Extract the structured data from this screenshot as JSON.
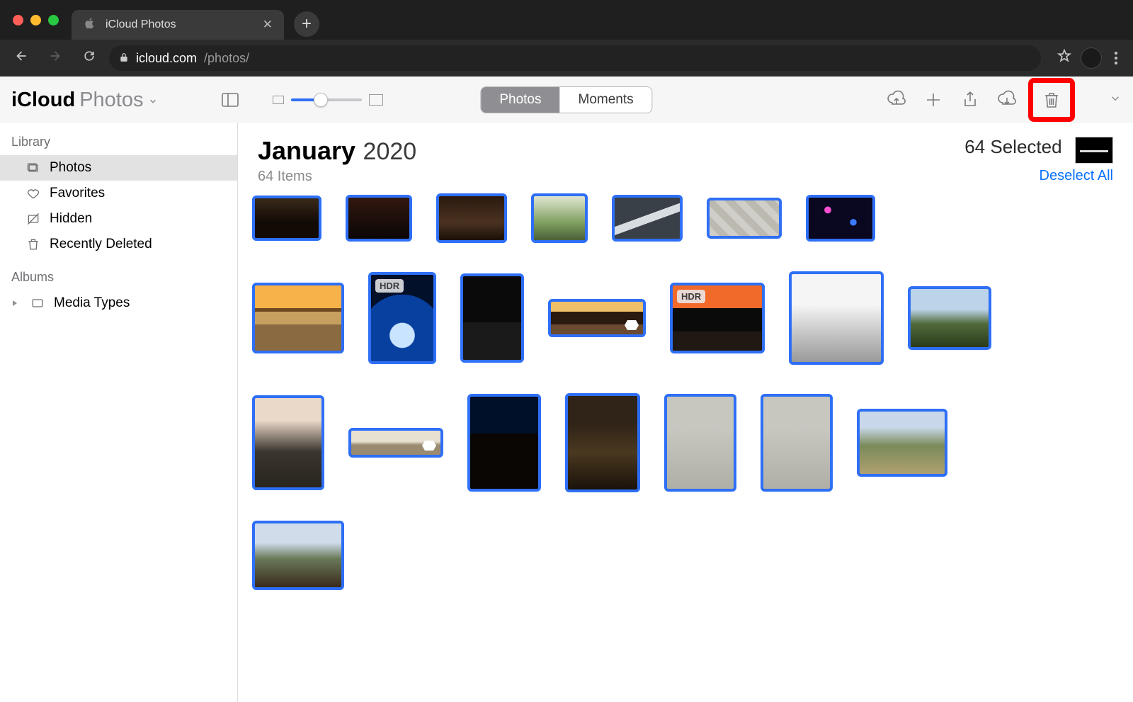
{
  "browser": {
    "tab_title": "iCloud Photos",
    "url_domain": "icloud.com",
    "url_path": "/photos/"
  },
  "app": {
    "title_strong": "iCloud",
    "title_light": "Photos",
    "segmented": {
      "photos": "Photos",
      "moments": "Moments",
      "active": "photos"
    }
  },
  "sidebar": {
    "library_header": "Library",
    "albums_header": "Albums",
    "items": {
      "photos": "Photos",
      "favorites": "Favorites",
      "hidden": "Hidden",
      "recdel": "Recently Deleted",
      "media": "Media Types"
    }
  },
  "main": {
    "month": "January",
    "year": "2020",
    "item_count": "64 Items",
    "selected_count": "64 Selected",
    "deselect": "Deselect All",
    "hdr_badge": "HDR"
  }
}
